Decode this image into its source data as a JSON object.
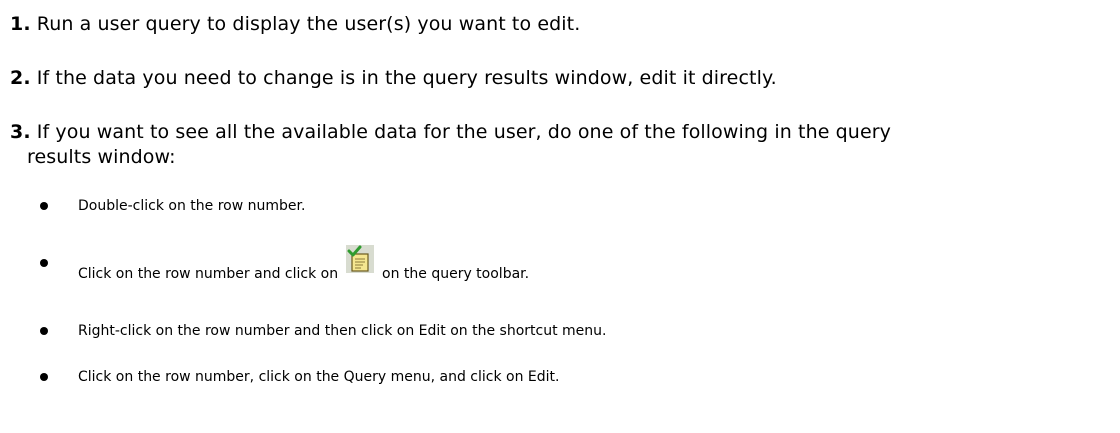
{
  "steps": [
    {
      "number": "1.",
      "text": "Run a user query to display the user(s) you want to edit."
    },
    {
      "number": "2.",
      "text": "If the data you need to change is in the query results window, edit it directly."
    },
    {
      "number": "3.",
      "text_line1": "If you want to see all the available data for the user, do one of the following in the query",
      "text_line2": "results window:"
    }
  ],
  "bullets": {
    "item1": "Double-click on the row number.",
    "item2_before": "Click on the row number and click on",
    "item2_after": "on the query toolbar.",
    "item2_icon": "edit-record-icon",
    "item3": "Right-click on the row number and then click on Edit on the shortcut menu.",
    "item4": "Click on the row number, click on the Query menu, and click on Edit."
  },
  "colors": {
    "icon_background": "#d8dcd0",
    "icon_checkmark": "#2f9b2f",
    "icon_page": "#f5e690"
  }
}
